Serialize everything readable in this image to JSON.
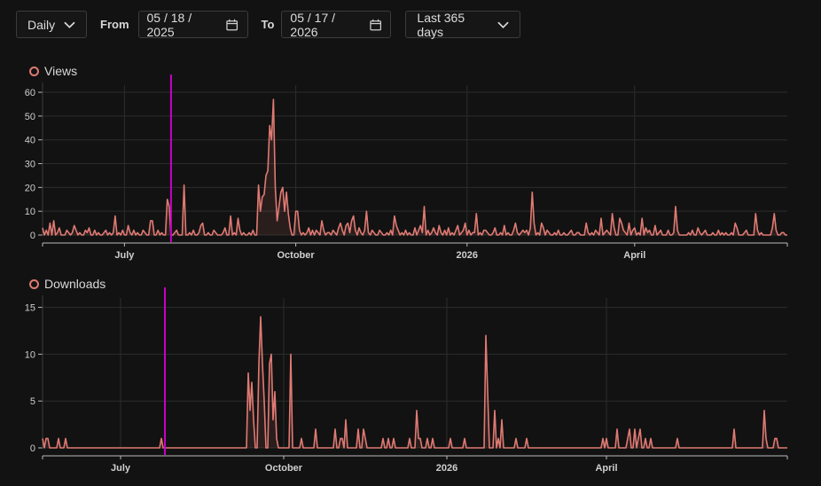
{
  "toolbar": {
    "granularity": "Daily",
    "from_label": "From",
    "from_date": "05 / 18 / 2025",
    "to_label": "To",
    "to_date": "05 / 17 / 2026",
    "range": "Last 365 days"
  },
  "colors": {
    "line": "#e07a73",
    "marker": "#c800c8",
    "grid": "#2c2c2c"
  },
  "chart_data": [
    {
      "type": "area",
      "title": "Views",
      "ylim": [
        0,
        63
      ],
      "yticks": [
        0,
        10,
        20,
        30,
        40,
        50,
        60
      ],
      "xticks": [
        "July",
        "October",
        "2026",
        "April"
      ],
      "grid": true,
      "x_range": [
        "2025-05-18",
        "2026-05-17"
      ],
      "values": [
        3,
        0,
        2,
        0,
        5,
        0,
        6,
        0,
        1,
        3,
        0,
        0,
        0,
        2,
        1,
        0,
        1,
        4,
        2,
        0,
        1,
        0,
        0,
        2,
        1,
        3,
        0,
        0,
        2,
        0,
        1,
        0,
        0,
        1,
        2,
        0,
        1,
        0,
        1,
        8,
        0,
        1,
        0,
        2,
        0,
        0,
        4,
        1,
        0,
        2,
        0,
        1,
        0,
        0,
        2,
        1,
        0,
        0,
        6,
        6,
        0,
        0,
        2,
        0,
        1,
        0,
        0,
        15,
        12,
        0,
        0,
        1,
        2,
        0,
        0,
        0,
        21,
        0,
        0,
        1,
        0,
        2,
        0,
        0,
        1,
        4,
        5,
        0,
        0,
        1,
        0,
        0,
        2,
        1,
        0,
        0,
        0,
        1,
        3,
        0,
        0,
        8,
        0,
        1,
        0,
        7,
        2,
        0,
        1,
        0,
        0,
        1,
        0,
        2,
        0,
        0,
        21,
        10,
        16,
        17,
        25,
        27,
        46,
        40,
        57,
        20,
        6,
        12,
        18,
        20,
        10,
        18,
        9,
        3,
        0,
        0,
        10,
        10,
        2,
        0,
        1,
        0,
        1,
        3,
        0,
        2,
        0,
        2,
        1,
        0,
        6,
        2,
        0,
        1,
        1,
        0,
        2,
        1,
        0,
        3,
        5,
        2,
        0,
        4,
        5,
        1,
        6,
        8,
        2,
        0,
        3,
        1,
        0,
        2,
        10,
        1,
        0,
        2,
        1,
        0,
        0,
        2,
        1,
        0,
        0,
        1,
        0,
        2,
        0,
        8,
        4,
        2,
        0,
        1,
        0,
        2,
        0,
        1,
        0,
        0,
        3,
        0,
        2,
        4,
        1,
        12,
        0,
        2,
        0,
        1,
        3,
        1,
        0,
        4,
        1,
        0,
        2,
        0,
        3,
        0,
        1,
        0,
        2,
        4,
        0,
        1,
        2,
        5,
        0,
        2,
        0,
        1,
        1,
        9,
        0,
        1,
        0,
        2,
        2,
        1,
        0,
        0,
        1,
        3,
        0,
        0,
        1,
        0,
        4,
        0,
        1,
        0,
        0,
        2,
        5,
        1,
        0,
        1,
        2,
        1,
        2,
        0,
        3,
        18,
        5,
        0,
        1,
        0,
        5,
        3,
        0,
        2,
        1,
        0,
        0,
        1,
        0,
        2,
        0,
        0,
        1,
        0,
        0,
        1,
        2,
        0,
        0,
        1,
        1,
        0,
        0,
        0,
        5,
        1,
        0,
        1,
        0,
        2,
        1,
        0,
        7,
        0,
        1,
        2,
        1,
        0,
        9,
        3,
        0,
        0,
        7,
        5,
        2,
        1,
        0,
        5,
        0,
        2,
        3,
        0,
        1,
        0,
        7,
        0,
        3,
        1,
        2,
        0,
        0,
        4,
        0,
        1,
        2,
        0,
        0,
        0,
        2,
        0,
        0,
        1,
        12,
        2,
        0,
        0,
        0,
        0,
        0,
        1,
        0,
        2,
        0,
        0,
        3,
        1,
        0,
        1,
        2,
        0,
        0,
        0,
        1,
        0,
        0,
        2,
        0,
        1,
        0,
        1,
        0,
        0,
        1,
        0,
        5,
        3,
        0,
        0,
        0,
        1,
        2,
        0,
        0,
        0,
        0,
        9,
        2,
        0,
        1,
        0,
        0,
        0,
        0,
        0,
        3,
        9,
        2,
        0,
        0,
        1,
        1,
        0,
        0
      ]
    },
    {
      "type": "area",
      "title": "Downloads",
      "ylim": [
        0,
        16
      ],
      "yticks": [
        0,
        5,
        10,
        15
      ],
      "xticks": [
        "July",
        "October",
        "2026",
        "April"
      ],
      "grid": true,
      "x_range": [
        "2025-05-18",
        "2026-05-17"
      ],
      "values": [
        1,
        0,
        1,
        1,
        0,
        0,
        0,
        0,
        0,
        1,
        0,
        0,
        0,
        1,
        0,
        0,
        0,
        0,
        0,
        0,
        0,
        0,
        0,
        0,
        0,
        0,
        0,
        0,
        0,
        0,
        0,
        0,
        0,
        0,
        0,
        0,
        0,
        0,
        0,
        0,
        0,
        0,
        0,
        0,
        0,
        0,
        0,
        0,
        0,
        0,
        0,
        0,
        0,
        0,
        0,
        0,
        0,
        0,
        0,
        0,
        0,
        0,
        0,
        0,
        0,
        0,
        0,
        1,
        0,
        0,
        0,
        0,
        0,
        0,
        0,
        0,
        0,
        0,
        0,
        0,
        0,
        0,
        0,
        0,
        0,
        0,
        0,
        0,
        0,
        0,
        0,
        0,
        0,
        0,
        0,
        0,
        0,
        0,
        0,
        0,
        0,
        0,
        0,
        0,
        0,
        0,
        0,
        0,
        0,
        0,
        0,
        0,
        0,
        0,
        0,
        0,
        8,
        4,
        7,
        3,
        0,
        0,
        9,
        14,
        9,
        5,
        0,
        0,
        9,
        10,
        3,
        6,
        1,
        0,
        0,
        0,
        0,
        0,
        0,
        0,
        10,
        0,
        0,
        0,
        0,
        0,
        1,
        0,
        0,
        0,
        0,
        0,
        0,
        0,
        2,
        0,
        0,
        0,
        0,
        0,
        0,
        0,
        0,
        0,
        0,
        2,
        0,
        0,
        1,
        1,
        0,
        3,
        0,
        0,
        0,
        0,
        0,
        0,
        2,
        0,
        0,
        2,
        1,
        0,
        0,
        0,
        0,
        0,
        0,
        0,
        0,
        0,
        1,
        0,
        0,
        1,
        0,
        0,
        1,
        0,
        0,
        0,
        0,
        0,
        0,
        0,
        0,
        1,
        0,
        0,
        0,
        4,
        1,
        1,
        0,
        0,
        0,
        1,
        0,
        0,
        1,
        0,
        0,
        0,
        0,
        0,
        0,
        0,
        0,
        0,
        1,
        0,
        0,
        0,
        0,
        0,
        0,
        0,
        1,
        0,
        0,
        0,
        0,
        0,
        0,
        0,
        0,
        0,
        0,
        0,
        12,
        6,
        0,
        0,
        0,
        4,
        0,
        1,
        0,
        3,
        0,
        0,
        0,
        0,
        0,
        0,
        0,
        1,
        0,
        0,
        0,
        0,
        0,
        1,
        0,
        0,
        0,
        0,
        0,
        0,
        0,
        0,
        0,
        0,
        0,
        0,
        0,
        0,
        0,
        0,
        0,
        0,
        0,
        0,
        0,
        0,
        0,
        0,
        0,
        0,
        0,
        0,
        0,
        0,
        0,
        0,
        0,
        0,
        0,
        0,
        0,
        0,
        0,
        0,
        0,
        0,
        1,
        0,
        1,
        0,
        0,
        0,
        0,
        0,
        2,
        0,
        0,
        0,
        0,
        0,
        1,
        2,
        0,
        0,
        2,
        0,
        1,
        2,
        0,
        0,
        1,
        0,
        0,
        1,
        0,
        0,
        0,
        0,
        0,
        0,
        0,
        0,
        0,
        0,
        0,
        0,
        0,
        0,
        1,
        0,
        0,
        0,
        0,
        0,
        0,
        0,
        0,
        0,
        0,
        0,
        0,
        0,
        0,
        0,
        0,
        0,
        0,
        0,
        0,
        0,
        0,
        0,
        0,
        0,
        0,
        0,
        0,
        0,
        0,
        0,
        2,
        0,
        0,
        0,
        0,
        0,
        0,
        0,
        0,
        0,
        0,
        0,
        0,
        0,
        0,
        0,
        0,
        4,
        1,
        0,
        0,
        0,
        0,
        1,
        1,
        0,
        0,
        0,
        0,
        0,
        0
      ]
    }
  ]
}
